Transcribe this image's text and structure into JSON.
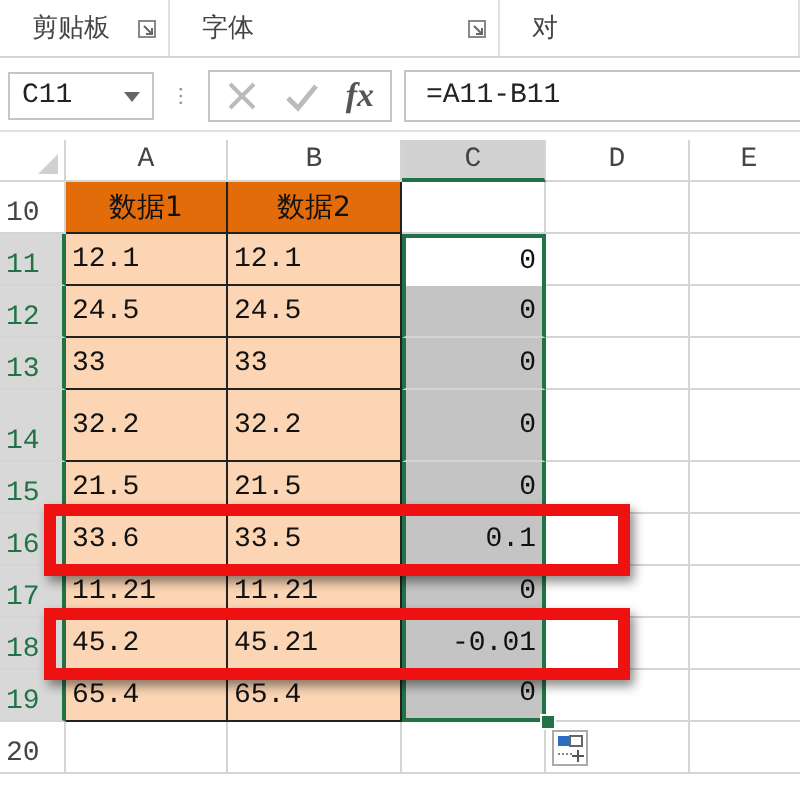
{
  "ribbon": {
    "groups": [
      {
        "label": "剪贴板",
        "launcher": true
      },
      {
        "label": "字体",
        "launcher": true
      },
      {
        "label": "对",
        "launcher": false
      }
    ]
  },
  "formula_bar": {
    "name_box": "C11",
    "function_button": "fx",
    "formula": "=A11-B11"
  },
  "columns": [
    {
      "label": "A",
      "selected": false
    },
    {
      "label": "B",
      "selected": false
    },
    {
      "label": "C",
      "selected": true
    },
    {
      "label": "D",
      "selected": false
    },
    {
      "label": "E",
      "selected": false
    }
  ],
  "rows": [
    {
      "number": "10",
      "kind": "header",
      "selected": false,
      "highlighted": false,
      "cells": [
        "数据1",
        "数据2",
        ""
      ]
    },
    {
      "number": "11",
      "kind": "data",
      "selected": true,
      "active": true,
      "highlighted": false,
      "cells": [
        "12.1",
        "12.1",
        "0"
      ]
    },
    {
      "number": "12",
      "kind": "data",
      "selected": true,
      "active": false,
      "highlighted": false,
      "cells": [
        "24.5",
        "24.5",
        "0"
      ]
    },
    {
      "number": "13",
      "kind": "data",
      "selected": true,
      "active": false,
      "highlighted": false,
      "cells": [
        "33",
        "33",
        "0"
      ]
    },
    {
      "number": "14",
      "kind": "data",
      "selected": true,
      "active": false,
      "highlighted": false,
      "tall": true,
      "cells": [
        "32.2",
        "32.2",
        "0"
      ]
    },
    {
      "number": "15",
      "kind": "data",
      "selected": true,
      "active": false,
      "highlighted": false,
      "cells": [
        "21.5",
        "21.5",
        "0"
      ]
    },
    {
      "number": "16",
      "kind": "data",
      "selected": true,
      "active": false,
      "highlighted": true,
      "cells": [
        "33.6",
        "33.5",
        "0.1"
      ]
    },
    {
      "number": "17",
      "kind": "data",
      "selected": true,
      "active": false,
      "highlighted": false,
      "cells": [
        "11.21",
        "11.21",
        "0"
      ]
    },
    {
      "number": "18",
      "kind": "data",
      "selected": true,
      "active": false,
      "highlighted": true,
      "cells": [
        "45.2",
        "45.21",
        "-0.01"
      ]
    },
    {
      "number": "19",
      "kind": "data",
      "selected": true,
      "active": false,
      "highlighted": false,
      "cells": [
        "65.4",
        "65.4",
        "0"
      ]
    },
    {
      "number": "20",
      "kind": "empty",
      "selected": false,
      "highlighted": false,
      "quick_analysis": true,
      "cells": [
        "",
        "",
        ""
      ]
    }
  ]
}
